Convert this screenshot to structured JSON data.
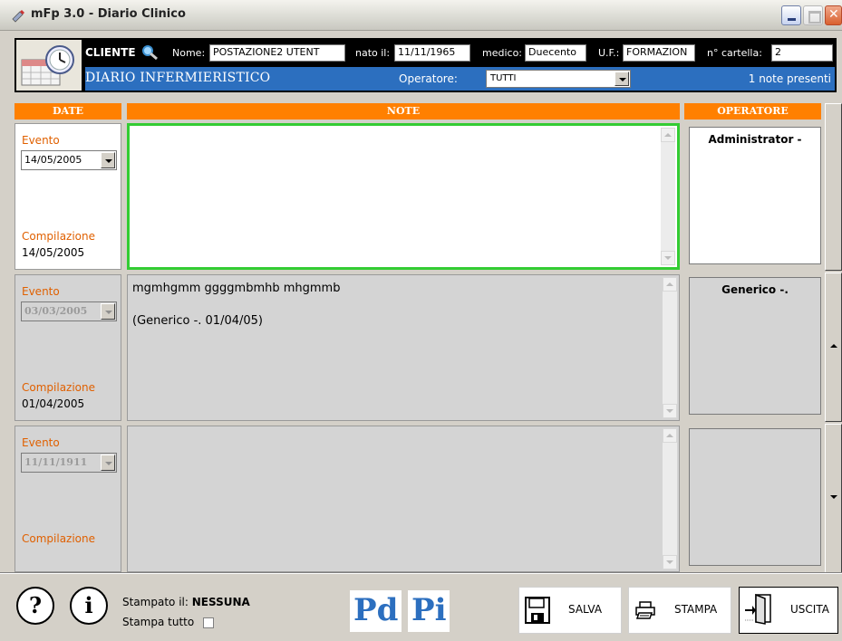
{
  "window": {
    "title": "mFp 3.0 - Diario Clinico"
  },
  "client": {
    "cliente_label": "CLIENTE",
    "nome_label": "Nome:",
    "nome_value": "POSTAZIONE2 UTENT",
    "nato_label": "nato il:",
    "nato_value": "11/11/1965",
    "medico_label": "medico:",
    "medico_value": "Duecento",
    "uf_label": "U.F.:",
    "uf_value": "FORMAZION",
    "cartella_label": "n° cartella:",
    "cartella_value": "2"
  },
  "diario": {
    "title": "DIARIO INFERMIERISTICO",
    "operatore_label": "Operatore:",
    "operatore_value": "TUTTI",
    "note_count": "1 note presenti"
  },
  "columns": {
    "date": "DATE",
    "note": "NOTE",
    "operatore": "OPERATORE"
  },
  "records": [
    {
      "evento_label": "Evento",
      "evento_date": "14/05/2005",
      "compilazione_label": "Compilazione",
      "compilazione_date": "14/05/2005",
      "note_line1": "",
      "note_line2": "",
      "operator": "Administrator -"
    },
    {
      "evento_label": "Evento",
      "evento_date": "03/03/2005",
      "compilazione_label": "Compilazione",
      "compilazione_date": "01/04/2005",
      "note_line1": "mgmhgmm ggggmbmhb mhgmmb",
      "note_line2": "(Generico -. 01/04/05)",
      "operator": "Generico -."
    },
    {
      "evento_label": "Evento",
      "evento_date": "11/11/1911",
      "compilazione_label": "Compilazione",
      "compilazione_date": "",
      "note_line1": "",
      "note_line2": "",
      "operator": ""
    }
  ],
  "footer": {
    "stampato_label": "Stampato il:",
    "stampato_value": "NESSUNA",
    "stampa_tutto_label": "Stampa tutto",
    "pd_label": "Pd",
    "pi_label": "Pi",
    "salva_label": "SALVA",
    "stampa_label": "STAMPA",
    "uscita_label": "USCITA"
  },
  "colors": {
    "accent_orange": "#ff8000",
    "accent_blue": "#2c6fbf",
    "active_border": "#33cc33"
  }
}
